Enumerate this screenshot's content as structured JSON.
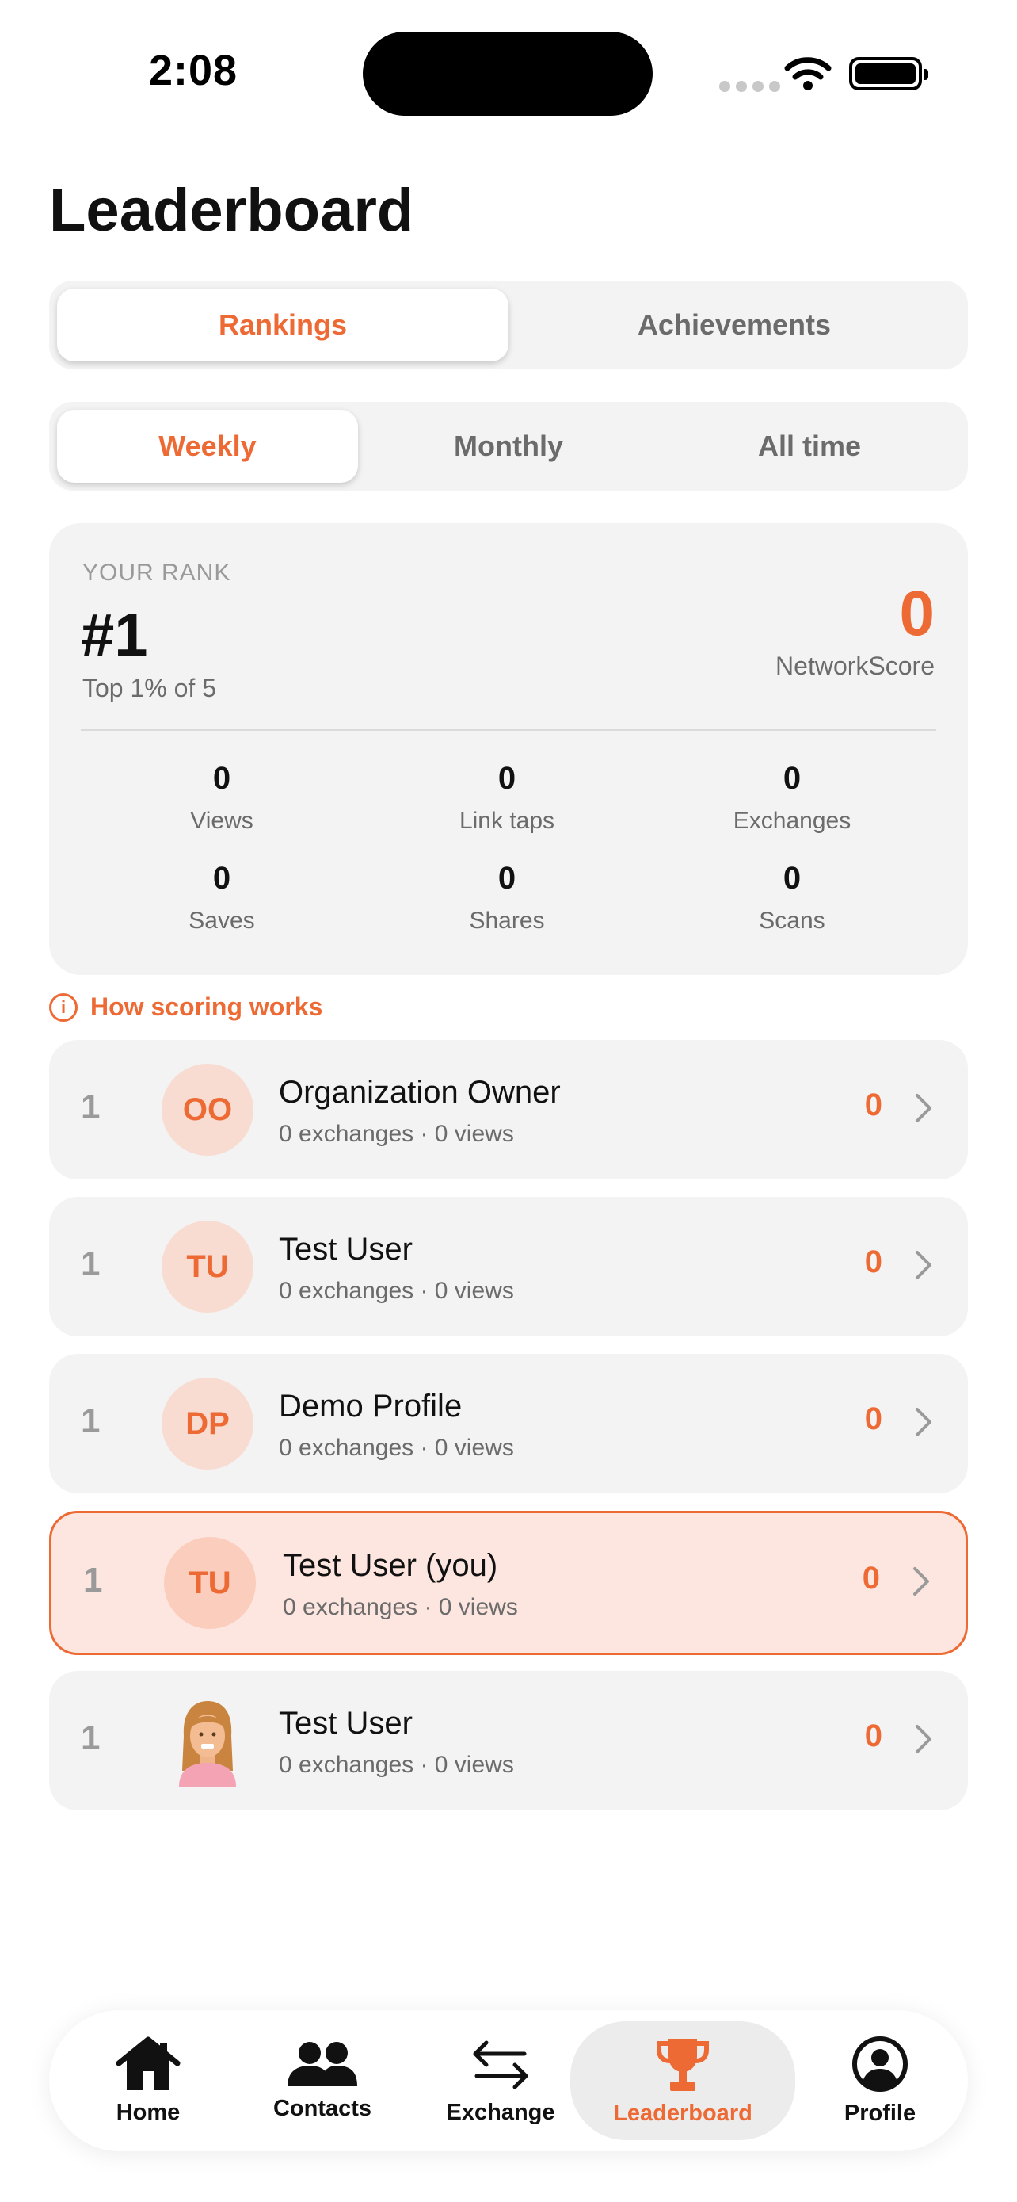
{
  "status_bar": {
    "time": "2:08"
  },
  "page": {
    "title": "Leaderboard"
  },
  "view_tabs": [
    {
      "label": "Rankings",
      "active": true
    },
    {
      "label": "Achievements",
      "active": false
    }
  ],
  "period_tabs": [
    {
      "label": "Weekly",
      "active": true
    },
    {
      "label": "Monthly",
      "active": false
    },
    {
      "label": "All time",
      "active": false
    }
  ],
  "your_rank": {
    "label": "YOUR RANK",
    "rank": "#1",
    "subtitle": "Top 1% of 5",
    "score": "0",
    "score_label": "NetworkScore",
    "stats": [
      {
        "value": "0",
        "label": "Views"
      },
      {
        "value": "0",
        "label": "Link taps"
      },
      {
        "value": "0",
        "label": "Exchanges"
      },
      {
        "value": "0",
        "label": "Saves"
      },
      {
        "value": "0",
        "label": "Shares"
      },
      {
        "value": "0",
        "label": "Scans"
      }
    ]
  },
  "how_scoring": {
    "label": "How scoring works"
  },
  "rows": [
    {
      "position": "1",
      "initials": "OO",
      "name": "Organization Owner",
      "meta": "0 exchanges · 0 views",
      "score": "0"
    },
    {
      "position": "1",
      "initials": "TU",
      "name": "Test User",
      "meta": "0 exchanges · 0 views",
      "score": "0"
    },
    {
      "position": "1",
      "initials": "DP",
      "name": "Demo Profile",
      "meta": "0 exchanges · 0 views",
      "score": "0"
    },
    {
      "position": "1",
      "initials": "TU",
      "name": "Test User  (you)",
      "meta": "0 exchanges · 0 views",
      "score": "0",
      "is_you": true
    },
    {
      "position": "1",
      "initials": "",
      "name": "Test User",
      "meta": "0 exchanges · 0 views",
      "score": "0",
      "avatar": "person-photo"
    }
  ],
  "tab_bar": [
    {
      "label": "Home",
      "icon": "home-icon"
    },
    {
      "label": "Contacts",
      "icon": "contacts-icon"
    },
    {
      "label": "Exchange",
      "icon": "exchange-icon"
    },
    {
      "label": "Leaderboard",
      "icon": "trophy-icon",
      "active": true
    },
    {
      "label": "Profile",
      "icon": "profile-icon"
    }
  ],
  "colors": {
    "accent": "#ee6a35",
    "card": "#f3f3f3",
    "you_bg": "#fde6df"
  }
}
